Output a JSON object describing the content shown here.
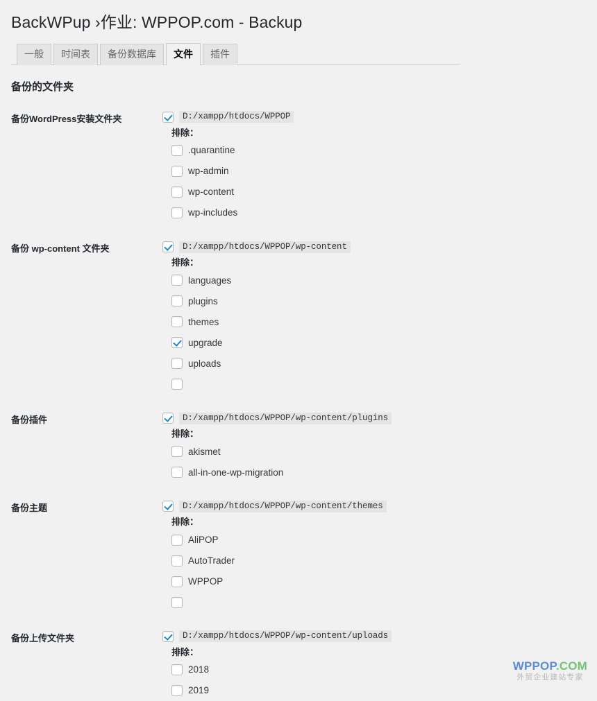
{
  "header": {
    "title": "BackWPup ›作业: WPPOP.com - Backup"
  },
  "tabs": [
    {
      "label": "一般",
      "active": false
    },
    {
      "label": "时间表",
      "active": false
    },
    {
      "label": "备份数据库",
      "active": false
    },
    {
      "label": "文件",
      "active": true
    },
    {
      "label": "插件",
      "active": false
    }
  ],
  "section": {
    "heading": "备份的文件夹",
    "exclude_label": "排除："
  },
  "rows": [
    {
      "label": "备份WordPress安装文件夹",
      "path": "D:/xampp/htdocs/WPPOP",
      "path_checked": true,
      "excludes": [
        {
          "label": ".quarantine",
          "checked": false
        },
        {
          "label": "wp-admin",
          "checked": false
        },
        {
          "label": "wp-content",
          "checked": false
        },
        {
          "label": "wp-includes",
          "checked": false
        }
      ],
      "trailing_blank": false
    },
    {
      "label": "备份 wp-content 文件夹",
      "path": "D:/xampp/htdocs/WPPOP/wp-content",
      "path_checked": true,
      "excludes": [
        {
          "label": "languages",
          "checked": false
        },
        {
          "label": "plugins",
          "checked": false
        },
        {
          "label": "themes",
          "checked": false
        },
        {
          "label": "upgrade",
          "checked": true
        },
        {
          "label": "uploads",
          "checked": false
        }
      ],
      "trailing_blank": true
    },
    {
      "label": "备份插件",
      "path": "D:/xampp/htdocs/WPPOP/wp-content/plugins",
      "path_checked": true,
      "excludes": [
        {
          "label": "akismet",
          "checked": false
        },
        {
          "label": "all-in-one-wp-migration",
          "checked": false
        }
      ],
      "trailing_blank": false
    },
    {
      "label": "备份主题",
      "path": "D:/xampp/htdocs/WPPOP/wp-content/themes",
      "path_checked": true,
      "excludes": [
        {
          "label": "AliPOP",
          "checked": false
        },
        {
          "label": "AutoTrader",
          "checked": false
        },
        {
          "label": "WPPOP",
          "checked": false
        }
      ],
      "trailing_blank": true
    },
    {
      "label": "备份上传文件夹",
      "path": "D:/xampp/htdocs/WPPOP/wp-content/uploads",
      "path_checked": true,
      "excludes": [
        {
          "label": "2018",
          "checked": false
        },
        {
          "label": "2019",
          "checked": false
        }
      ],
      "trailing_blank": false
    }
  ],
  "watermark": {
    "main_primary": "WPPOP",
    "main_secondary": ".COM",
    "subtitle": "外贸企业建站专家",
    "color_primary": "#5b8dd6",
    "color_secondary": "#74c476"
  }
}
